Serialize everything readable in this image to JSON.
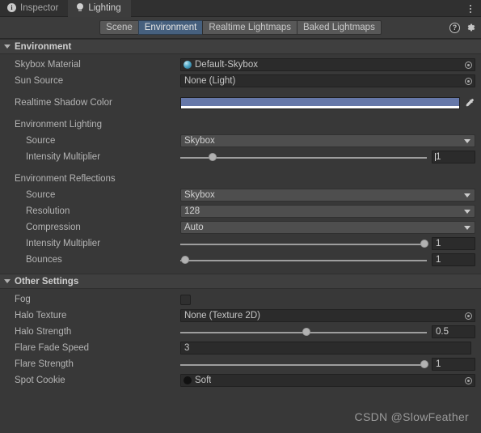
{
  "window_tabs": [
    {
      "label": "Inspector",
      "icon": "info-icon",
      "active": false
    },
    {
      "label": "Lighting",
      "icon": "lightbulb-icon",
      "active": true
    }
  ],
  "toolbar": {
    "tabs": [
      {
        "label": "Scene",
        "selected": false
      },
      {
        "label": "Environment",
        "selected": true
      },
      {
        "label": "Realtime Lightmaps",
        "selected": false
      },
      {
        "label": "Baked Lightmaps",
        "selected": false
      }
    ],
    "help_label": "?",
    "selected_accent": "#46607e"
  },
  "environment": {
    "header": "Environment",
    "skybox_material": {
      "label": "Skybox Material",
      "value": "Default-Skybox"
    },
    "sun_source": {
      "label": "Sun Source",
      "value": "None (Light)"
    },
    "realtime_shadow_color": {
      "label": "Realtime Shadow Color",
      "color": "#6678a9",
      "alpha_color": "#ffffff"
    },
    "lighting_group": "Environment Lighting",
    "lighting_source": {
      "label": "Source",
      "value": "Skybox"
    },
    "lighting_intensity": {
      "label": "Intensity Multiplier",
      "value": "1",
      "percent": 13
    },
    "reflections_group": "Environment Reflections",
    "refl_source": {
      "label": "Source",
      "value": "Skybox"
    },
    "refl_resolution": {
      "label": "Resolution",
      "value": "128"
    },
    "refl_compression": {
      "label": "Compression",
      "value": "Auto"
    },
    "refl_intensity": {
      "label": "Intensity Multiplier",
      "value": "1",
      "percent": 97
    },
    "refl_bounces": {
      "label": "Bounces",
      "value": "1",
      "percent": 2
    }
  },
  "other_settings": {
    "header": "Other Settings",
    "fog": {
      "label": "Fog",
      "checked": false
    },
    "halo_texture": {
      "label": "Halo Texture",
      "value": "None (Texture 2D)"
    },
    "halo_strength": {
      "label": "Halo Strength",
      "value": "0.5",
      "percent": 50
    },
    "flare_fade_speed": {
      "label": "Flare Fade Speed",
      "value": "3"
    },
    "flare_strength": {
      "label": "Flare Strength",
      "value": "1",
      "percent": 97
    },
    "spot_cookie": {
      "label": "Spot Cookie",
      "value": "Soft"
    }
  },
  "watermark": "CSDN @SlowFeather"
}
